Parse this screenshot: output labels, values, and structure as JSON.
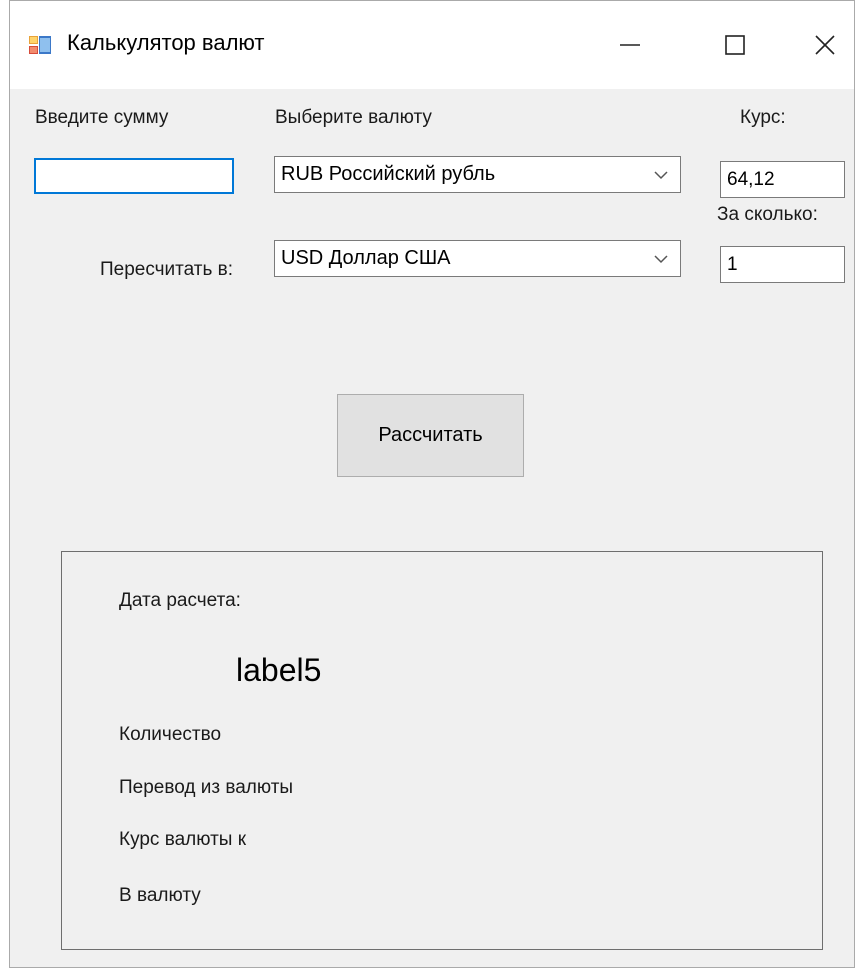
{
  "window": {
    "title": "Калькулятор валют",
    "icon": "windows-forms-app-icon"
  },
  "title_buttons": {
    "minimize": "minimize-icon",
    "maximize": "maximize-icon",
    "close": "close-icon"
  },
  "labels": {
    "enter_amount": "Введите сумму",
    "choose_currency": "Выберите валюту",
    "rate": "Курс:",
    "for_how_many": "За сколько:",
    "convert_to": "Пересчитать в:"
  },
  "inputs": {
    "amount": {
      "value": ""
    },
    "rate": {
      "value": "64,12"
    },
    "for_how_many": {
      "value": "1"
    }
  },
  "selects": {
    "from_currency": {
      "value": "RUB Российский рубль"
    },
    "to_currency": {
      "value": "USD Доллар США"
    }
  },
  "button": {
    "calculate": "Рассчитать"
  },
  "result": {
    "date_label": "Дата расчета:",
    "big_value": "label5",
    "quantity": "Количество",
    "from_currency": "Перевод из валюты",
    "rate_to": "Курс валюты к",
    "to_currency": "В валюту"
  },
  "colors": {
    "window_bg": "#f0f0f0",
    "titlebar_bg": "#ffffff",
    "focus_border": "#0078d7",
    "button_bg": "#e1e1e1"
  }
}
